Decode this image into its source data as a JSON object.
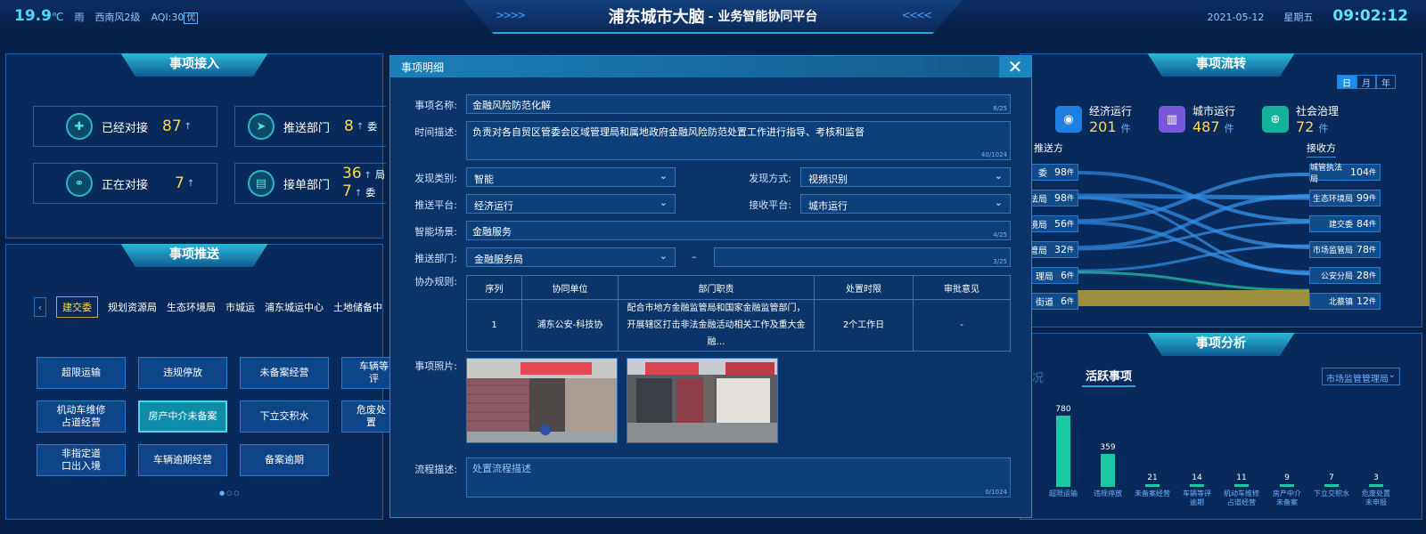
{
  "header": {
    "temp": "19.9",
    "temp_unit": "℃",
    "weather": "雨",
    "wind": "西南风2级",
    "aqi": "AQI:30",
    "aqi_level": "优",
    "title": "浦东城市大脑",
    "subtitle": "- 业务智能协同平台",
    "date": "2021-05-12",
    "weekday": "星期五",
    "time": "09:02:12"
  },
  "intake": {
    "title": "事项接入",
    "stats": [
      {
        "label": "已经对接",
        "value": "87",
        "icon": "plus-icon"
      },
      {
        "label": "推送部门",
        "value": "8",
        "value2": "",
        "suffix": "委",
        "icon": "send-icon"
      },
      {
        "label": "正在对接",
        "value": "7",
        "icon": "link-icon"
      },
      {
        "label": "接单部门",
        "value": "36",
        "value2": "7",
        "suffix": "局",
        "suffix2": "委",
        "icon": "document-icon"
      }
    ]
  },
  "push": {
    "title": "事项推送",
    "tabs": [
      "建交委",
      "规划资源局",
      "生态环境局",
      "市城运",
      "浦东城运中心",
      "土地储备中"
    ],
    "buttons": [
      "超限运输",
      "违规停放",
      "未备案经营",
      "车辆等评",
      "机动车维修\n占道经营",
      "房产中介未备案",
      "下立交积水",
      "危废处置",
      "非指定道\n口出入境",
      "车辆逾期经营",
      "备案逾期"
    ]
  },
  "flow": {
    "title": "事项流转",
    "seg": [
      "日",
      "月",
      "年"
    ],
    "categories": [
      {
        "label": "经济运行",
        "value": "201",
        "unit": "件",
        "color": "#1f7fe0",
        "icon": "database-icon"
      },
      {
        "label": "城市运行",
        "value": "487",
        "unit": "件",
        "color": "#7a56d8",
        "icon": "building-icon"
      },
      {
        "label": "社会治理",
        "value": "72",
        "unit": "件",
        "color": "#12b39a",
        "icon": "globe-icon"
      }
    ],
    "sender_label": "推送方",
    "receiver_label": "接收方",
    "senders": [
      {
        "name": "委",
        "value": "98",
        "unit": "件"
      },
      {
        "name": "法局",
        "value": "98",
        "unit": "件"
      },
      {
        "name": "境局",
        "value": "56",
        "unit": "件"
      },
      {
        "name": "管局",
        "value": "32",
        "unit": "件"
      },
      {
        "name": "理局",
        "value": "6",
        "unit": "件"
      },
      {
        "name": "街道",
        "value": "6",
        "unit": "件"
      }
    ],
    "receivers": [
      {
        "name": "城管执法局",
        "value": "104",
        "unit": "件"
      },
      {
        "name": "生态环境局",
        "value": "99",
        "unit": "件"
      },
      {
        "name": "建交委",
        "value": "84",
        "unit": "件"
      },
      {
        "name": "市场监管局",
        "value": "78",
        "unit": "件"
      },
      {
        "name": "公安分局",
        "value": "28",
        "unit": "件"
      },
      {
        "name": "北蔡镇",
        "value": "12",
        "unit": "件"
      }
    ]
  },
  "analysis": {
    "title": "事项分析",
    "tab_partial": "况",
    "tab_active": "活跃事项",
    "dropdown": "市场监管管理局"
  },
  "chart_data": {
    "type": "bar",
    "categories": [
      "超限运输",
      "违规停放",
      "未备案经营",
      "车辆等评逾期",
      "机动车维修占道经营",
      "房产中介未备案",
      "下立交积水",
      "危废处置未申报"
    ],
    "values": [
      780,
      359,
      21,
      14,
      11,
      9,
      7,
      3
    ],
    "category_labels": [
      "超限运输",
      "违规停放",
      "未备案经营",
      "车辆等评\n逾期",
      "机动车维修\n占道经营",
      "房产中介\n未备案",
      "下立交积水",
      "危废处置\n未申报"
    ],
    "title": "",
    "xlabel": "",
    "ylabel": ""
  },
  "modal": {
    "title": "事项明细",
    "name_label": "事项名称:",
    "name_value": "金融风险防范化解",
    "name_count": "8/25",
    "desc_label": "时间描述:",
    "desc_value": "负责对各自贸区管委会区域管理局和属地政府金融风险防范处置工作进行指导、考核和监督",
    "desc_count": "40/1024",
    "discover_type_label": "发现类别:",
    "discover_type": "智能",
    "discover_mode_label": "发现方式:",
    "discover_mode": "视频识别",
    "push_platform_label": "推送平台:",
    "push_platform": "经济运行",
    "recv_platform_label": "接收平台:",
    "recv_platform": "城市运行",
    "scene_label": "智能场景:",
    "scene": "金融服务",
    "scene_count": "4/25",
    "dept_label": "推送部门:",
    "dept": "金融服务局",
    "dash": "–",
    "dept2_count": "3/25",
    "rules_label": "协办规则:",
    "table_head": [
      "序列",
      "协同单位",
      "部门职责",
      "处置时限",
      "审批意见"
    ],
    "table_row": [
      "1",
      "浦东公安-科技协",
      "配合市地方金融监管局和国家金融监管部门，开展辖区打击非法金融活动相关工作及重大金融…",
      "2个工作日",
      "-"
    ],
    "photo_label": "事项照片:",
    "process_label": "流程描述:",
    "process_placeholder": "处置流程描述",
    "process_count": "0/1024"
  }
}
